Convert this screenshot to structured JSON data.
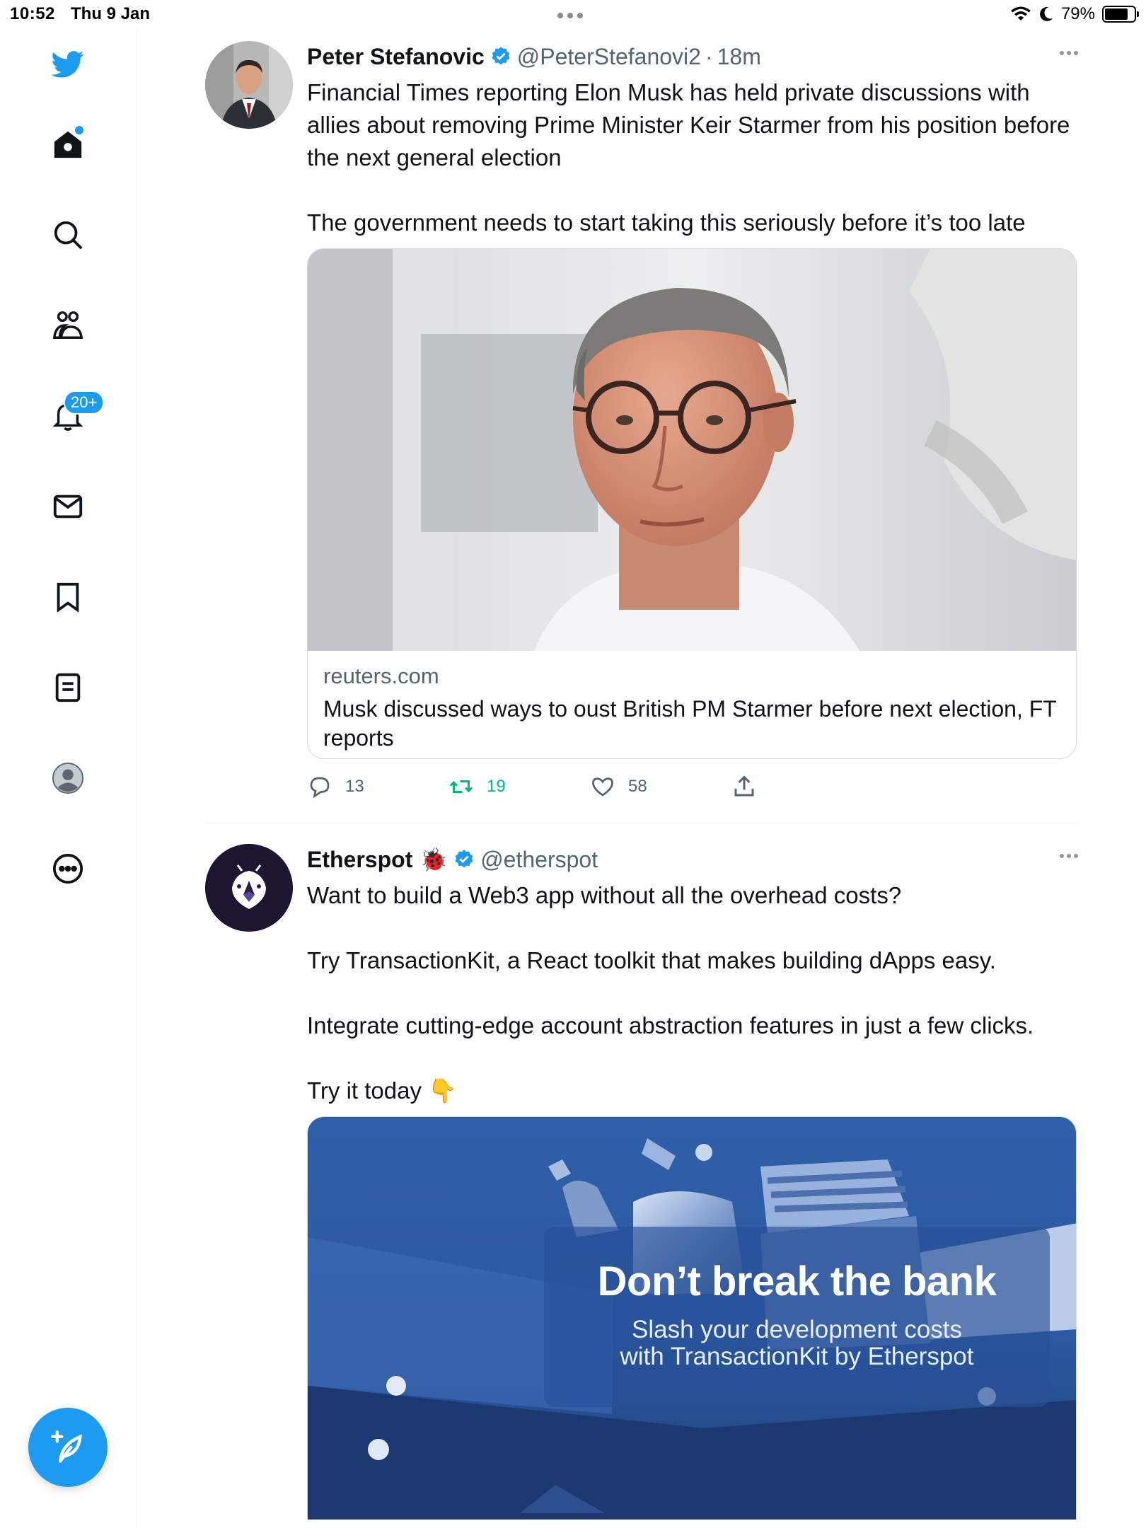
{
  "status_bar": {
    "time": "10:52",
    "date": "Thu 9 Jan",
    "battery": "79%",
    "battery_level": 0.79
  },
  "sidebar": {
    "items": [
      {
        "name": "twitter-logo",
        "icon": "twitter-bird-icon"
      },
      {
        "name": "home",
        "icon": "home-icon"
      },
      {
        "name": "search",
        "icon": "search-icon"
      },
      {
        "name": "communities",
        "icon": "communities-icon"
      },
      {
        "name": "notifications",
        "icon": "bell-icon",
        "badge": "20+"
      },
      {
        "name": "messages",
        "icon": "envelope-icon"
      },
      {
        "name": "bookmarks",
        "icon": "bookmark-icon"
      },
      {
        "name": "lists",
        "icon": "list-icon"
      },
      {
        "name": "profile",
        "icon": "profile-avatar-icon"
      },
      {
        "name": "more",
        "icon": "more-circle-icon"
      }
    ],
    "compose_icon": "compose-feather-icon",
    "accent": "#1d9bf0"
  },
  "tweets": [
    {
      "author": "Peter Stefanovic",
      "handle": "@PeterStefanovi2",
      "separator": "·",
      "time": "18m",
      "text": [
        "Financial Times reporting Elon Musk has held private discussions with allies about removing Prime Minister Keir Starmer from his position before the next general election",
        "The government needs to start taking this seriously before it’s too late"
      ],
      "card": {
        "domain": "reuters.com",
        "title": "Musk discussed ways to oust British PM Starmer before next election, FT reports"
      },
      "stats": {
        "replies": "13",
        "retweets": "19",
        "likes": "58"
      }
    },
    {
      "author": "Etherspot",
      "author_emoji": "🐞",
      "handle": "@etherspot",
      "text": [
        "Want to build a Web3 app without all the overhead costs?",
        "Try TransactionKit, a React toolkit that makes building dApps easy.",
        "Integrate cutting-edge account abstraction features in just a few clicks.",
        "Try it today 👇"
      ],
      "promo": {
        "title": "Don’t break the bank",
        "subtitle_line1": "Slash your development costs",
        "subtitle_line2": "with TransactionKit by Etherspot"
      }
    }
  ]
}
